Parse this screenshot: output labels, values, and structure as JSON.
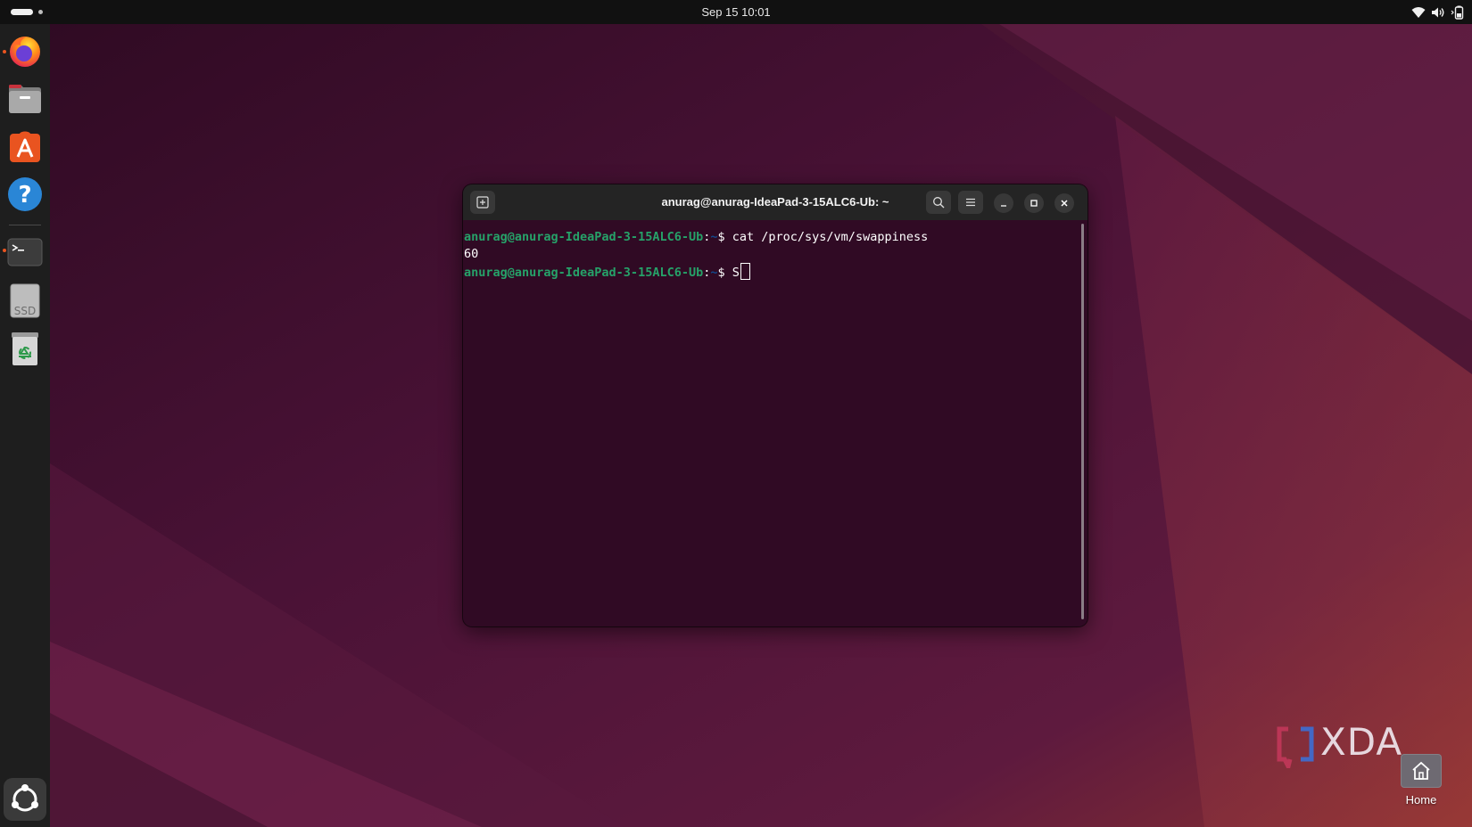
{
  "topbar": {
    "clock": "Sep 15  10:01",
    "tray_icons": [
      "wifi-icon",
      "volume-icon",
      "battery-icon"
    ]
  },
  "dock": {
    "items": [
      {
        "name": "Firefox",
        "icon": "firefox-icon",
        "running": true
      },
      {
        "name": "Files",
        "icon": "files-icon",
        "running": false
      },
      {
        "name": "App Center",
        "icon": "app-center-icon",
        "running": false
      },
      {
        "name": "Help",
        "icon": "help-icon",
        "running": false
      },
      {
        "name": "Terminal",
        "icon": "terminal-icon",
        "running": true
      },
      {
        "name": "SSD",
        "icon": "ssd-drive-icon",
        "label": "SSD",
        "running": false
      },
      {
        "name": "Trash",
        "icon": "trash-icon",
        "running": false
      },
      {
        "name": "Show Apps",
        "icon": "show-apps-icon",
        "running": false
      }
    ]
  },
  "terminal": {
    "title": "anurag@anurag-IdeaPad-3-15ALC6-Ub: ~",
    "lines": [
      {
        "prompt_user": "anurag@anurag-IdeaPad-3-15ALC6-Ub",
        "prompt_path": "~",
        "prompt_symbol": "$",
        "command": " cat /proc/sys/vm/swappiness"
      },
      {
        "output": "60"
      },
      {
        "prompt_user": "anurag@anurag-IdeaPad-3-15ALC6-Ub",
        "prompt_path": "~",
        "prompt_symbol": "$",
        "command": " S"
      }
    ],
    "prompt_colon": ":"
  },
  "desktop": {
    "home_label": "Home"
  },
  "watermark": {
    "text": "XDA"
  },
  "colors": {
    "terminal_bg": "#300a24",
    "prompt_green": "#26a269",
    "prompt_blue": "#12488b",
    "accent_orange": "#e95420",
    "dock_bg": "#1e1e1e",
    "topbar_bg": "#111111"
  }
}
